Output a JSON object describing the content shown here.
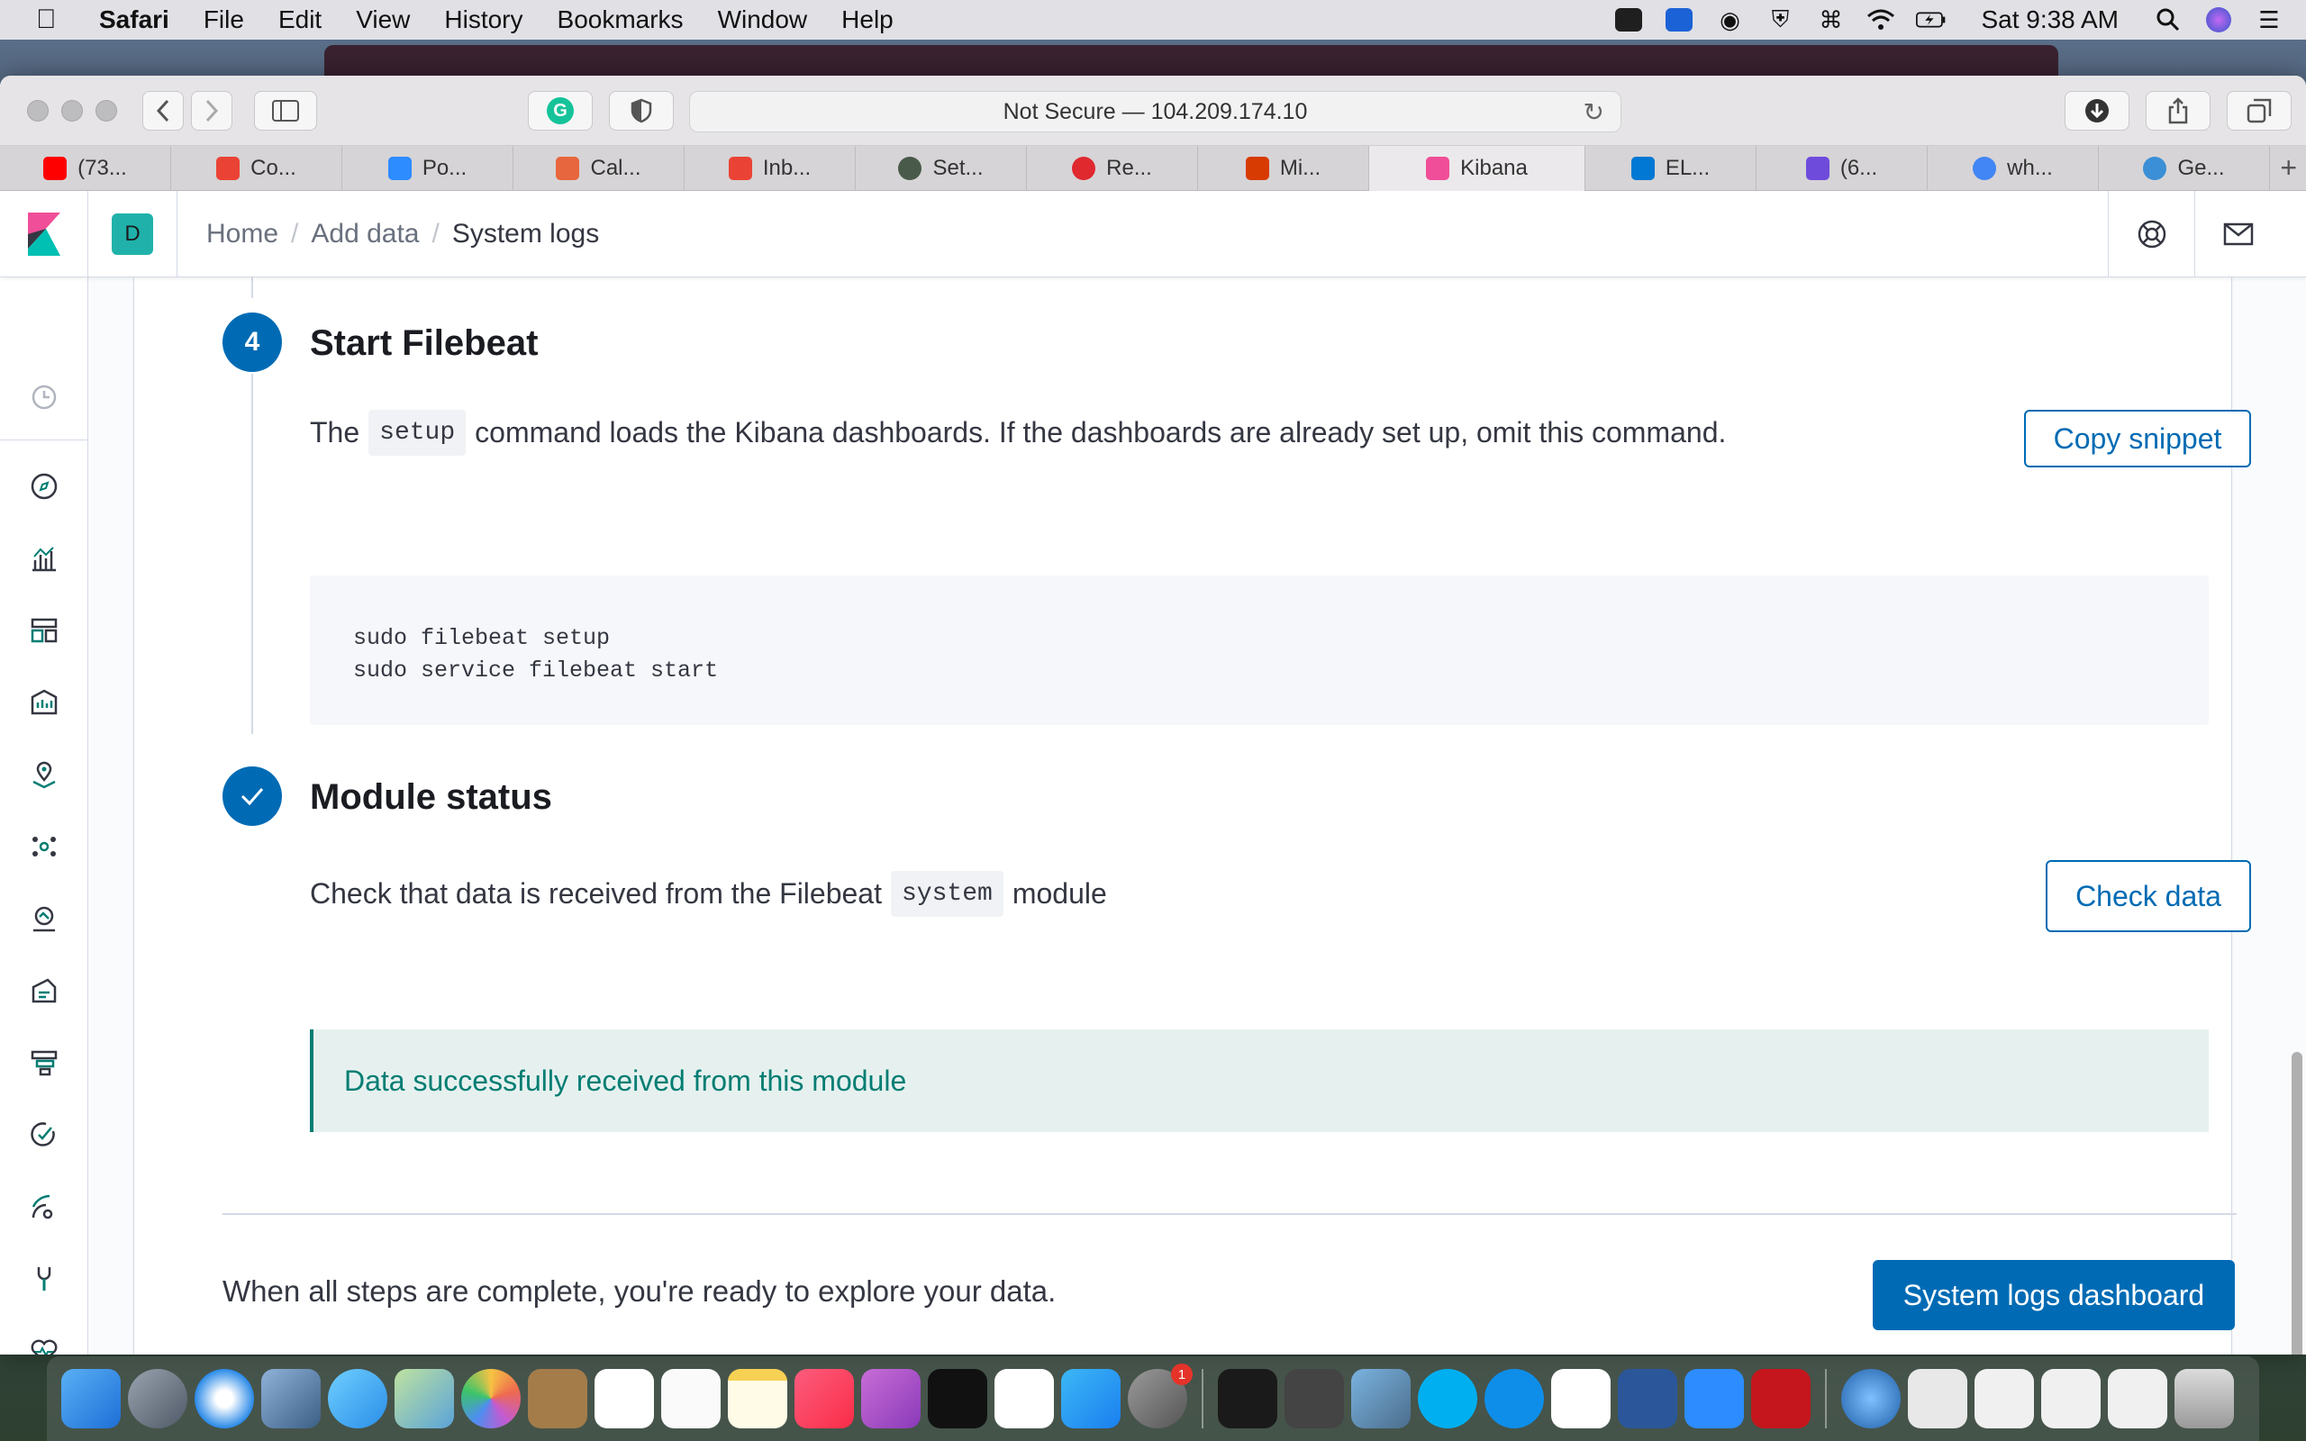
{
  "menubar": {
    "app": "Safari",
    "items": [
      "File",
      "Edit",
      "View",
      "History",
      "Bookmarks",
      "Window",
      "Help"
    ],
    "clock": "Sat 9:38 AM"
  },
  "browser": {
    "address": "Not Secure — 104.209.174.10",
    "tabs": [
      {
        "label": "(73...",
        "color": "#ff0000"
      },
      {
        "label": "Co...",
        "color": "#ea4335"
      },
      {
        "label": "Po...",
        "color": "#2d8cff"
      },
      {
        "label": "Cal...",
        "color": "#e8663d"
      },
      {
        "label": "Inb...",
        "color": "#ea4335"
      },
      {
        "label": "Set...",
        "color": "#4a5a4a"
      },
      {
        "label": "Re...",
        "color": "#e0282f"
      },
      {
        "label": "Mi...",
        "color": "#d83b01"
      },
      {
        "label": "Kibana",
        "color": "#f04e98"
      },
      {
        "label": "EL...",
        "color": "#0078d4"
      },
      {
        "label": "(6...",
        "color": "#6f4bdc"
      },
      {
        "label": "wh...",
        "color": "#4285f4"
      },
      {
        "label": "Ge...",
        "color": "#3b8fd6"
      }
    ]
  },
  "kibana": {
    "space_initial": "D",
    "breadcrumbs": [
      "Home",
      "Add data",
      "System logs"
    ],
    "step4": {
      "number": "4",
      "title": "Start Filebeat",
      "text_before": "The",
      "code": "setup",
      "text_after": "command loads the Kibana dashboards. If the dashboards are already set up, omit this command.",
      "copy_button": "Copy snippet",
      "snippet_line1": "sudo filebeat setup",
      "snippet_line2": "sudo service filebeat start"
    },
    "module_status": {
      "title": "Module status",
      "text_before": "Check that data is received from the Filebeat",
      "code": "system",
      "text_after": "module",
      "check_button": "Check data",
      "success_message": "Data successfully received from this module"
    },
    "footer": {
      "text": "When all steps are complete, you're ready to explore your data.",
      "button": "System logs dashboard"
    }
  },
  "colors": {
    "primary": "#006bb4",
    "success": "#017d73",
    "space_avatar": "#20b2aa"
  }
}
